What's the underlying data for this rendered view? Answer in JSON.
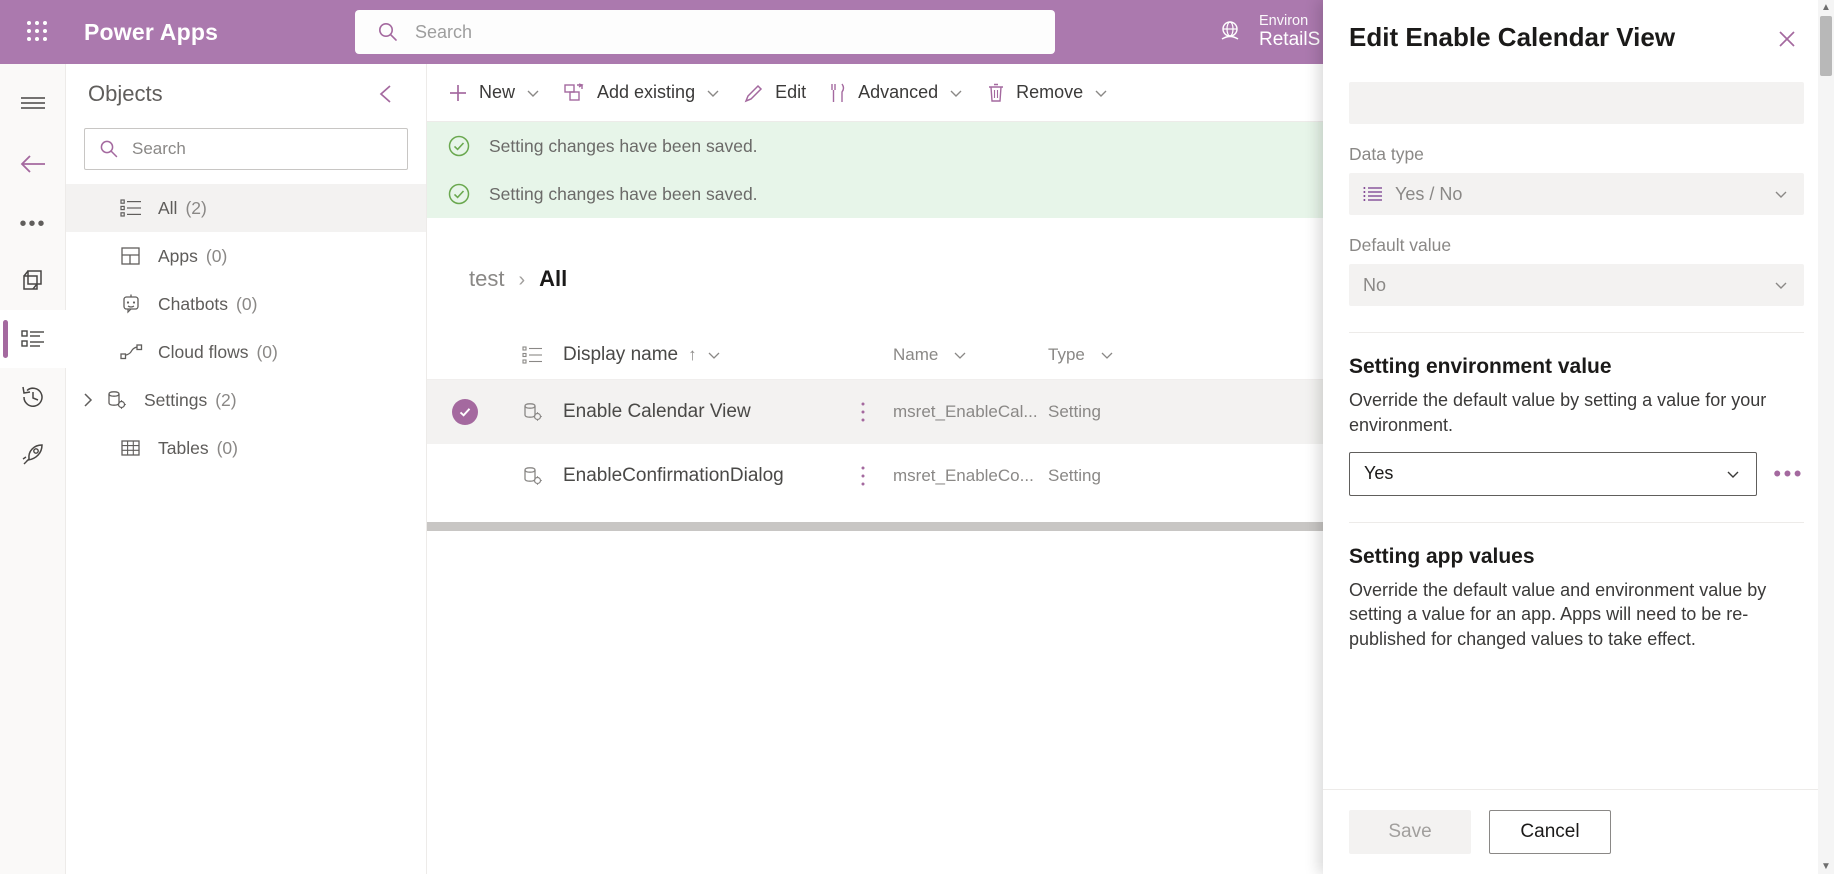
{
  "header": {
    "waffle_icon": "waffle-grid-icon",
    "brand": "Power Apps",
    "search": {
      "icon": "search-icon",
      "placeholder": "Search",
      "value": ""
    },
    "environment": {
      "icon": "globe-icon",
      "label": "Environ",
      "name": "RetailS"
    },
    "bg_color": "#ab79ae"
  },
  "rail": {
    "items": [
      {
        "name": "hamburger-icon",
        "active": false
      },
      {
        "name": "back-arrow-icon",
        "active": false
      },
      {
        "name": "more-dots-icon",
        "active": false
      },
      {
        "name": "solutions-icon",
        "active": false
      },
      {
        "name": "objects-list-icon",
        "active": true
      },
      {
        "name": "history-clock-icon",
        "active": false
      },
      {
        "name": "rocket-icon",
        "active": false
      }
    ],
    "accent_color": "#a4699f"
  },
  "objects": {
    "title": "Objects",
    "collapse_icon": "chevron-left-icon",
    "search": {
      "icon": "search-icon",
      "placeholder": "Search",
      "value": ""
    },
    "items": [
      {
        "label": "All",
        "count": "(2)",
        "icon": "list-icon",
        "selected": true,
        "expandable": false
      },
      {
        "label": "Apps",
        "count": "(0)",
        "icon": "apps-grid-icon",
        "selected": false,
        "expandable": false
      },
      {
        "label": "Chatbots",
        "count": "(0)",
        "icon": "chatbot-icon",
        "selected": false,
        "expandable": false
      },
      {
        "label": "Cloud flows",
        "count": "(0)",
        "icon": "cloud-flow-icon",
        "selected": false,
        "expandable": false
      },
      {
        "label": "Settings",
        "count": "(2)",
        "icon": "settings-db-icon",
        "selected": false,
        "expandable": true
      },
      {
        "label": "Tables",
        "count": "(0)",
        "icon": "table-icon",
        "selected": false,
        "expandable": false
      }
    ]
  },
  "toolbar": {
    "commands": [
      {
        "label": "New",
        "icon": "plus-icon",
        "chevron": true
      },
      {
        "label": "Add existing",
        "icon": "add-existing-icon",
        "chevron": true
      },
      {
        "label": "Edit",
        "icon": "pencil-icon",
        "chevron": false
      },
      {
        "label": "Advanced",
        "icon": "advanced-tools-icon",
        "chevron": true
      },
      {
        "label": "Remove",
        "icon": "trash-icon",
        "chevron": true
      }
    ]
  },
  "notifications": [
    {
      "icon": "success-check-icon",
      "text": "Setting changes have been saved."
    },
    {
      "icon": "success-check-icon",
      "text": "Setting changes have been saved."
    }
  ],
  "breadcrumb": {
    "parent": "test",
    "separator": "›",
    "current": "All"
  },
  "table": {
    "columns": [
      {
        "label": "Display name",
        "sort": "↑",
        "chevron": true
      },
      {
        "label": "Name",
        "sort": "",
        "chevron": true
      },
      {
        "label": "Type",
        "sort": "",
        "chevron": true
      }
    ],
    "rows": [
      {
        "selected": true,
        "row_icon": "settings-db-icon",
        "display_name": "Enable Calendar View",
        "menu_icon": "more-vertical-icon",
        "name": "msret_EnableCal...",
        "type": "Setting"
      },
      {
        "selected": false,
        "row_icon": "settings-db-icon",
        "display_name": "EnableConfirmationDialog",
        "menu_icon": "more-vertical-icon",
        "name": "msret_EnableCo...",
        "type": "Setting"
      }
    ]
  },
  "panel": {
    "title": "Edit Enable Calendar View",
    "close_icon": "close-icon",
    "fields": [
      {
        "label": "Data type",
        "value": "Yes / No",
        "icon": "list-lines-icon",
        "chevron_icon": "chevron-down-icon",
        "disabled": true
      },
      {
        "label": "Default value",
        "value": "No",
        "icon": "",
        "chevron_icon": "chevron-down-icon",
        "disabled": true
      }
    ],
    "sections": [
      {
        "title": "Setting environment value",
        "description": "Override the default value by setting a value for your environment.",
        "dropdown_value": "Yes",
        "dropdown_chevron": "chevron-down-icon",
        "overflow_icon": "ellipsis-icon"
      },
      {
        "title": "Setting app values",
        "description": "Override the default value and environment value by setting a value for an app. Apps will need to be re-published for changed values to take effect."
      }
    ],
    "footer": {
      "save_label": "Save",
      "save_disabled": true,
      "cancel_label": "Cancel"
    }
  }
}
